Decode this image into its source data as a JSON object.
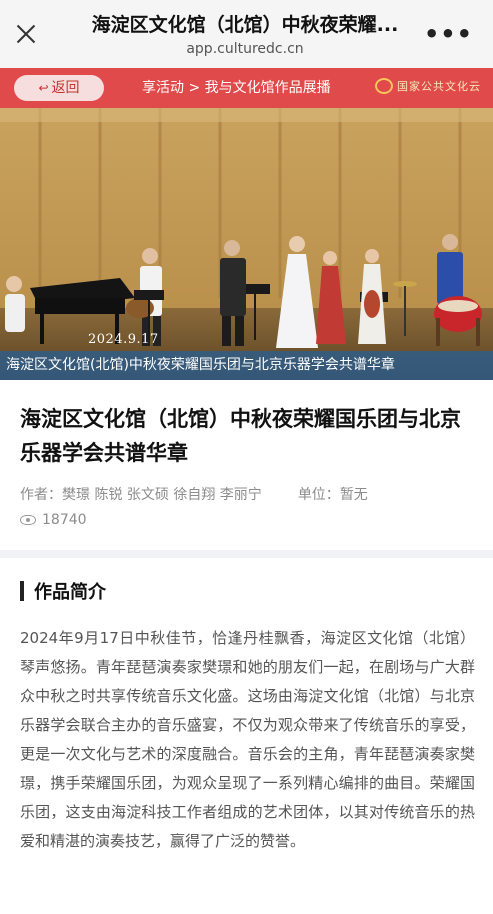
{
  "browser": {
    "title": "海淀区文化馆（北馆）中秋夜荣耀...",
    "url": "app.culturedc.cn",
    "more_label": "•••"
  },
  "nav": {
    "back_label": "返回",
    "breadcrumb": "享活动 > 我与文化馆作品展播",
    "logo_text": "国家公共文化云"
  },
  "photo": {
    "date": "2024.9.17",
    "caption": "海淀区文化馆(北馆)中秋夜荣耀国乐团与北京乐器学会共谱华章"
  },
  "article": {
    "title": "海淀区文化馆（北馆）中秋夜荣耀国乐团与北京乐器学会共谱华章",
    "author_label": "作者：",
    "authors": "樊璟 陈锐 张文硕 徐自翔 李丽宁",
    "unit_label": "单位：",
    "unit_value": "暂无",
    "views": "18740"
  },
  "intro": {
    "heading": "作品简介",
    "body": "2024年9月17日中秋佳节，恰逢丹桂飘香，海淀区文化馆（北馆）琴声悠扬。青年琵琶演奏家樊璟和她的朋友们一起，在剧场与广大群众中秋之时共享传统音乐文化盛。这场由海淀文化馆（北馆）与北京乐器学会联合主办的音乐盛宴，不仅为观众带来了传统音乐的享受，更是一次文化与艺术的深度融合。音乐会的主角，青年琵琶演奏家樊璟，携手荣耀国乐团，为观众呈现了一系列精心编排的曲目。荣耀国乐团，这支由海淀科技工作者组成的艺术团体，以其对传统音乐的热爱和精湛的演奏技艺，赢得了广泛的赞誉。"
  },
  "colors": {
    "nav_red": "#e14a4a",
    "caption_blue": "#285f96"
  }
}
